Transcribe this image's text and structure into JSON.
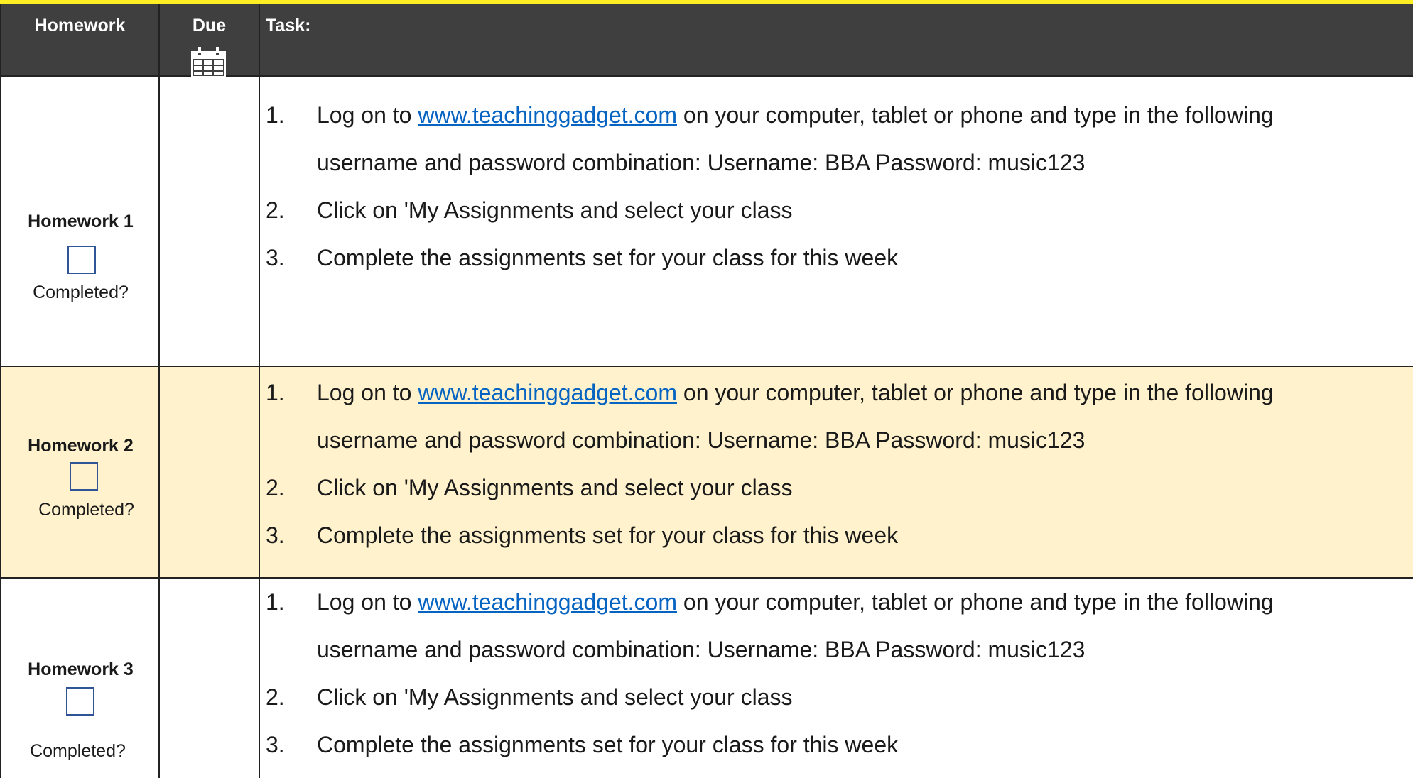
{
  "header": {
    "col_homework": "Homework",
    "col_due": "Due",
    "col_task": "Task:",
    "calendar_icon": "calendar-icon"
  },
  "colors": {
    "header_bg": "#3f3f3f",
    "highlight_row": "#fff2cc",
    "link": "#0563c1",
    "checkbox_border": "#2f5597",
    "top_strip": "#ffee22"
  },
  "rows": [
    {
      "title": "Homework 1",
      "completed_label": "Completed?",
      "task": {
        "n1": "1.",
        "prefix": "Log on to ",
        "link": "www.teachinggadget.com",
        "suffix": " on your computer, tablet or phone and type in the following",
        "line2": "username and password combination: Username: BBA   Password: music123",
        "n2": "2.",
        "step2": "Click on 'My Assignments and select your class",
        "n3": "3.",
        "step3": "Complete the assignments set for your class for this week"
      }
    },
    {
      "title": "Homework 2",
      "completed_label": "Completed?",
      "task": {
        "n1": "1.",
        "prefix": "Log on to ",
        "link": "www.teachinggadget.com",
        "suffix": " on your computer, tablet or phone and type in the following",
        "line2": "username and password combination: Username: BBA   Password: music123",
        "n2": "2.",
        "step2": "Click on 'My Assignments and select your class",
        "n3": "3.",
        "step3": "Complete the assignments set for your class for this week"
      }
    },
    {
      "title": "Homework 3",
      "completed_label": "Completed?",
      "task": {
        "n1": "1.",
        "prefix": "Log on to ",
        "link": "www.teachinggadget.com",
        "suffix": " on your computer, tablet or phone and type in the following",
        "line2": "username and password combination: Username: BBA   Password: music123",
        "n2": "2.",
        "step2": "Click on 'My Assignments and select your class",
        "n3": "3.",
        "step3": "Complete the assignments set for your class for this week"
      }
    }
  ]
}
